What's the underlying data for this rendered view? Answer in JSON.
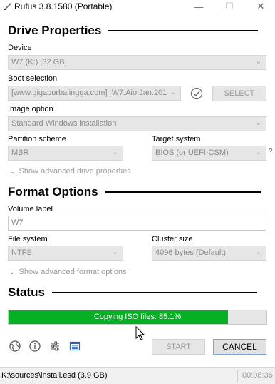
{
  "window": {
    "title": "Rufus 3.8.1580 (Portable)",
    "minimize_glyph": "—",
    "maximize_glyph": "☐",
    "close_glyph": "✕"
  },
  "drive_properties": {
    "header": "Drive Properties",
    "device_label": "Device",
    "device_value": "W7 (K:) [32 GB]",
    "boot_selection_label": "Boot selection",
    "boot_selection_value": "[www.gigapurbalingga.com]_W7.Aio.Jan.201",
    "select_button": "SELECT",
    "image_option_label": "Image option",
    "image_option_value": "Standard Windows installation",
    "partition_scheme_label": "Partition scheme",
    "partition_scheme_value": "MBR",
    "target_system_label": "Target system",
    "target_system_value": "BIOS (or UEFI-CSM)",
    "help_glyph": "?",
    "advanced_toggle": "Show advanced drive properties"
  },
  "format_options": {
    "header": "Format Options",
    "volume_label_label": "Volume label",
    "volume_label_value": "W7",
    "file_system_label": "File system",
    "file_system_value": "NTFS",
    "cluster_size_label": "Cluster size",
    "cluster_size_value": "4096 bytes (Default)",
    "advanced_toggle": "Show advanced format options"
  },
  "status": {
    "header": "Status",
    "progress_text": "Copying ISO files: 85.1%",
    "progress_fraction": 0.851,
    "progress_color": "#06b025"
  },
  "toolbar": {
    "icons": [
      "globe-icon",
      "info-icon",
      "settings-sliders-icon",
      "log-icon"
    ],
    "start_button": "START",
    "cancel_button": "CANCEL"
  },
  "statusbar": {
    "path": "K:\\sources\\install.esd (3.9 GB)",
    "timer": "00:08:36"
  }
}
